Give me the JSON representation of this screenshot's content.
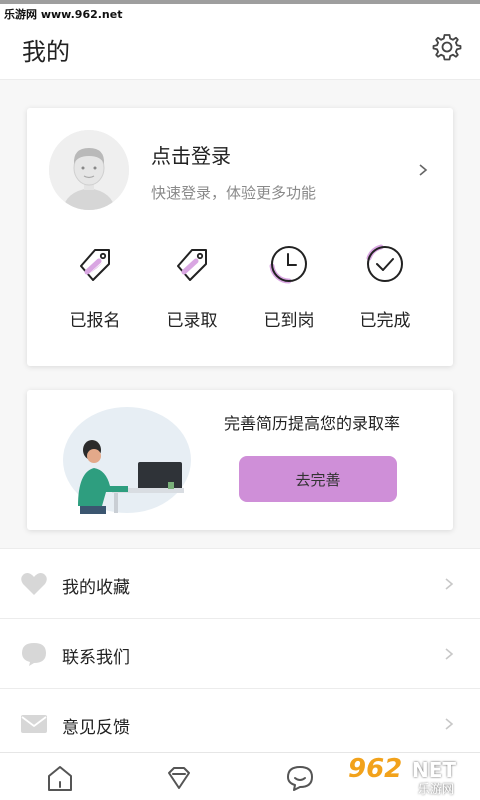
{
  "watermark": "乐游网 www.962.net",
  "header": {
    "title": "我的"
  },
  "login": {
    "title": "点击登录",
    "subtitle": "快速登录，体验更多功能"
  },
  "status_items": [
    {
      "label": "已报名",
      "icon": "tag-icon"
    },
    {
      "label": "已录取",
      "icon": "tag-icon"
    },
    {
      "label": "已到岗",
      "icon": "clock-icon"
    },
    {
      "label": "已完成",
      "icon": "check-circle-icon"
    }
  ],
  "resume": {
    "text": "完善简历提高您的录取率",
    "button": "去完善"
  },
  "menu": [
    {
      "label": "我的收藏",
      "icon": "heart-icon"
    },
    {
      "label": "联系我们",
      "icon": "chat-bubble-icon"
    },
    {
      "label": "意见反馈",
      "icon": "mail-icon"
    }
  ],
  "tabs": [
    "home-icon",
    "diamond-icon",
    "chat-icon"
  ],
  "logo": {
    "brand": "962",
    "suffix": "NET",
    "tagline": "乐游网"
  },
  "colors": {
    "accent": "#cf8fd8",
    "icon_highlight": "#d9a6e2"
  }
}
